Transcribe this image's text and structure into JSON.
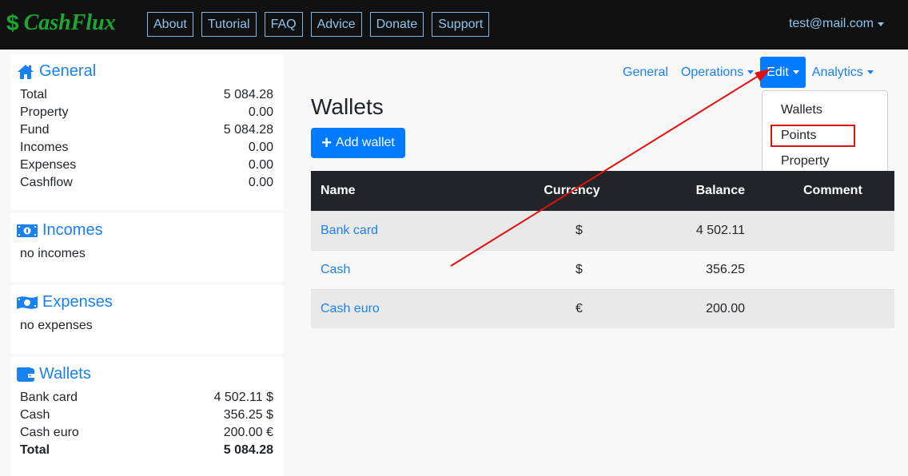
{
  "brand": {
    "symbol": "$",
    "name": "CashFlux",
    "color": "#1aa832"
  },
  "topnav": [
    "About",
    "Tutorial",
    "FAQ",
    "Advice",
    "Donate",
    "Support"
  ],
  "user": {
    "email": "test@mail.com"
  },
  "sidebar": {
    "general": {
      "title": "General",
      "icon": "home-icon",
      "rows": [
        {
          "label": "Total",
          "value": "5 084.28"
        },
        {
          "label": "Property",
          "value": "0.00"
        },
        {
          "label": "Fund",
          "value": "5 084.28"
        },
        {
          "label": "Incomes",
          "value": "0.00"
        },
        {
          "label": "Expenses",
          "value": "0.00"
        },
        {
          "label": "Cashflow",
          "value": "0.00"
        }
      ]
    },
    "incomes": {
      "title": "Incomes",
      "icon": "money-bill-icon",
      "empty": "no incomes"
    },
    "expenses": {
      "title": "Expenses",
      "icon": "money-bill-wave-icon",
      "empty": "no expenses"
    },
    "wallets": {
      "title": "Wallets",
      "icon": "wallet-icon",
      "rows": [
        {
          "label": "Bank card",
          "value": "4 502.11 $"
        },
        {
          "label": "Cash",
          "value": "356.25 $"
        },
        {
          "label": "Cash euro",
          "value": "200.00 €"
        }
      ],
      "total": {
        "label": "Total",
        "value": "5 084.28"
      }
    }
  },
  "subnav": {
    "items": [
      {
        "label": "General",
        "dropdown": false
      },
      {
        "label": "Operations",
        "dropdown": true
      },
      {
        "label": "Edit",
        "dropdown": true,
        "active": true
      },
      {
        "label": "Analytics",
        "dropdown": true
      }
    ],
    "edit_menu": [
      "Wallets",
      "Points",
      "Property"
    ],
    "highlighted_item": "Points"
  },
  "main": {
    "title": "Wallets",
    "add_button": "Add wallet",
    "table": {
      "columns": [
        "Name",
        "Currency",
        "Balance",
        "Comment"
      ],
      "rows": [
        {
          "name": "Bank card",
          "currency": "$",
          "balance": "4 502.11",
          "comment": ""
        },
        {
          "name": "Cash",
          "currency": "$",
          "balance": "356.25",
          "comment": ""
        },
        {
          "name": "Cash euro",
          "currency": "€",
          "balance": "200.00",
          "comment": ""
        }
      ]
    }
  },
  "annotation": {
    "color": "#e01010"
  },
  "colors": {
    "accent": "#007bff",
    "link": "#1a82f0",
    "topbar": "#111111",
    "table_header": "#212529"
  }
}
